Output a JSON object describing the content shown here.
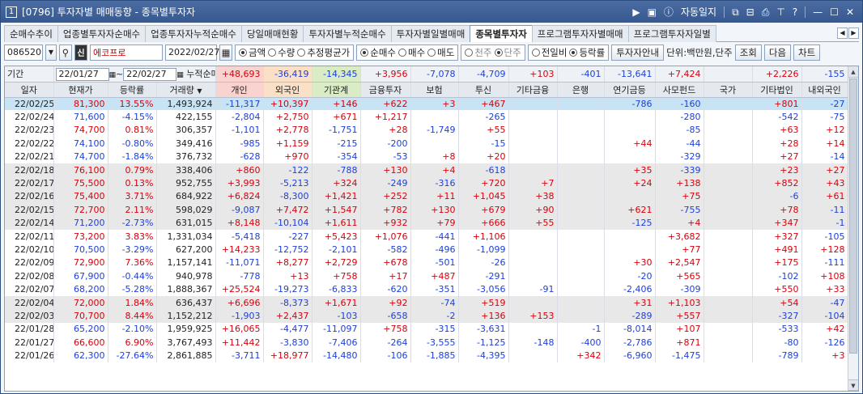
{
  "window": {
    "number": "1",
    "title": "[0796] 투자자별 매매동향 - 종목별투자자",
    "auto_log": "자동일지",
    "help": "?"
  },
  "tabs": [
    "순매수추이",
    "업종별투자자순매수",
    "업종투자자누적순매수",
    "당일매매현황",
    "투자자별누적순매수",
    "투자자별일별매매",
    "종목별투자자",
    "프로그램투자자별매매",
    "프로그램투자자일별"
  ],
  "active_tab": 6,
  "controls": {
    "code": "086520",
    "stock_name": "에코프로",
    "date": "2022/02/27",
    "radio1": [
      "금액",
      "수량",
      "추정평균가"
    ],
    "radio2": [
      "순매수",
      "매수",
      "매도"
    ],
    "radio3": [
      "천주",
      "단주"
    ],
    "radio4": [
      "전일비",
      "등락률"
    ],
    "guide_btn": "투자자안내",
    "unit": "단위:백만원,단주",
    "query": "조회",
    "next": "다음",
    "chart": "차트"
  },
  "period": {
    "label": "기간",
    "from": "22/01/27",
    "to": "22/02/27",
    "cum_label": "누적순매수"
  },
  "columns": [
    "일자",
    "현재가",
    "등락률",
    "거래량",
    "개인",
    "외국인",
    "기관계",
    "금융투자",
    "보험",
    "투신",
    "기타금융",
    "은행",
    "연기금등",
    "사모펀드",
    "국가",
    "기타법인",
    "내외국인"
  ],
  "sum": [
    "+48,693",
    "-36,419",
    "-14,345",
    "+3,956",
    "-7,078",
    "-4,709",
    "+103",
    "-401",
    "-13,641",
    "+7,424",
    "",
    "+2,226",
    "-155"
  ],
  "rows": [
    [
      "22/02/25",
      "81,300",
      "13.55%",
      "1,493,924",
      "-11,317",
      "+10,397",
      "+146",
      "+622",
      "+3",
      "+467",
      "",
      "",
      "-786",
      "-160",
      "",
      "+801",
      "-27"
    ],
    [
      "22/02/24",
      "71,600",
      "-4.15%",
      "422,155",
      "-2,804",
      "+2,750",
      "+671",
      "+1,217",
      "",
      "-265",
      "",
      "",
      "",
      "-280",
      "",
      "-542",
      "-75"
    ],
    [
      "22/02/23",
      "74,700",
      "0.81%",
      "306,357",
      "-1,101",
      "+2,778",
      "-1,751",
      "+28",
      "-1,749",
      "+55",
      "",
      "",
      "",
      "-85",
      "",
      "+63",
      "+12"
    ],
    [
      "22/02/22",
      "74,100",
      "-0.80%",
      "349,416",
      "-985",
      "+1,159",
      "-215",
      "-200",
      "",
      "-15",
      "",
      "",
      "+44",
      "-44",
      "",
      "+28",
      "+14"
    ],
    [
      "22/02/21",
      "74,700",
      "-1.84%",
      "376,732",
      "-628",
      "+970",
      "-354",
      "-53",
      "+8",
      "+20",
      "",
      "",
      "",
      "-329",
      "",
      "+27",
      "-14"
    ],
    [
      "22/02/18",
      "76,100",
      "0.79%",
      "338,406",
      "+860",
      "-122",
      "-788",
      "+130",
      "+4",
      "-618",
      "",
      "",
      "+35",
      "-339",
      "",
      "+23",
      "+27"
    ],
    [
      "22/02/17",
      "75,500",
      "0.13%",
      "952,755",
      "+3,993",
      "-5,213",
      "+324",
      "-249",
      "-316",
      "+720",
      "+7",
      "",
      "+24",
      "+138",
      "",
      "+852",
      "+43"
    ],
    [
      "22/02/16",
      "75,400",
      "3.71%",
      "684,922",
      "+6,824",
      "-8,300",
      "+1,421",
      "+252",
      "+11",
      "+1,045",
      "+38",
      "",
      "",
      "+75",
      "",
      "-6",
      "+61"
    ],
    [
      "22/02/15",
      "72,700",
      "2.11%",
      "598,029",
      "-9,087",
      "+7,472",
      "+1,547",
      "+782",
      "+130",
      "+679",
      "+90",
      "",
      "+621",
      "-755",
      "",
      "+78",
      "-11"
    ],
    [
      "22/02/14",
      "71,200",
      "-2.73%",
      "631,015",
      "+8,148",
      "-10,104",
      "+1,611",
      "+932",
      "+79",
      "+666",
      "+55",
      "",
      "-125",
      "+4",
      "",
      "+347",
      "-1"
    ],
    [
      "22/02/11",
      "73,200",
      "3.83%",
      "1,331,034",
      "-5,418",
      "-227",
      "+5,423",
      "+1,076",
      "-441",
      "+1,106",
      "",
      "",
      "",
      "+3,682",
      "",
      "+327",
      "-105"
    ],
    [
      "22/02/10",
      "70,500",
      "-3.29%",
      "627,200",
      "+14,233",
      "-12,752",
      "-2,101",
      "-582",
      "-496",
      "-1,099",
      "",
      "",
      "",
      "+77",
      "",
      "+491",
      "+128"
    ],
    [
      "22/02/09",
      "72,900",
      "7.36%",
      "1,157,141",
      "-11,071",
      "+8,277",
      "+2,729",
      "+678",
      "-501",
      "-26",
      "",
      "",
      "+30",
      "+2,547",
      "",
      "+175",
      "-111"
    ],
    [
      "22/02/08",
      "67,900",
      "-0.44%",
      "940,978",
      "-778",
      "+13",
      "+758",
      "+17",
      "+487",
      "-291",
      "",
      "",
      "-20",
      "+565",
      "",
      "-102",
      "+108"
    ],
    [
      "22/02/07",
      "68,200",
      "-5.28%",
      "1,888,367",
      "+25,524",
      "-19,273",
      "-6,833",
      "-620",
      "-351",
      "-3,056",
      "-91",
      "",
      "-2,406",
      "-309",
      "",
      "+550",
      "+33"
    ],
    [
      "22/02/04",
      "72,000",
      "1.84%",
      "636,437",
      "+6,696",
      "-8,373",
      "+1,671",
      "+92",
      "-74",
      "+519",
      "",
      "",
      "+31",
      "+1,103",
      "",
      "+54",
      "-47"
    ],
    [
      "22/02/03",
      "70,700",
      "8.44%",
      "1,152,212",
      "-1,903",
      "+2,437",
      "-103",
      "-658",
      "-2",
      "+136",
      "+153",
      "",
      "-289",
      "+557",
      "",
      "-327",
      "-104"
    ],
    [
      "22/01/28",
      "65,200",
      "-2.10%",
      "1,959,925",
      "+16,065",
      "-4,477",
      "-11,097",
      "+758",
      "-315",
      "-3,631",
      "",
      "-1",
      "-8,014",
      "+107",
      "",
      "-533",
      "+42"
    ],
    [
      "22/01/27",
      "66,600",
      "6.90%",
      "3,767,493",
      "+11,442",
      "-3,830",
      "-7,406",
      "-264",
      "-3,555",
      "-1,125",
      "-148",
      "-400",
      "-2,786",
      "+871",
      "",
      "-80",
      "-126"
    ],
    [
      "22/01/26",
      "62,300",
      "-27.64%",
      "2,861,885",
      "-3,711",
      "+18,977",
      "-14,480",
      "-106",
      "-1,885",
      "-4,395",
      "",
      "+342",
      "-6,960",
      "-1,475",
      "",
      "-789",
      "+3"
    ]
  ],
  "colors": {
    "positive": "#d8000c",
    "negative": "#1e40d8",
    "selected": "#c8e3f3"
  }
}
